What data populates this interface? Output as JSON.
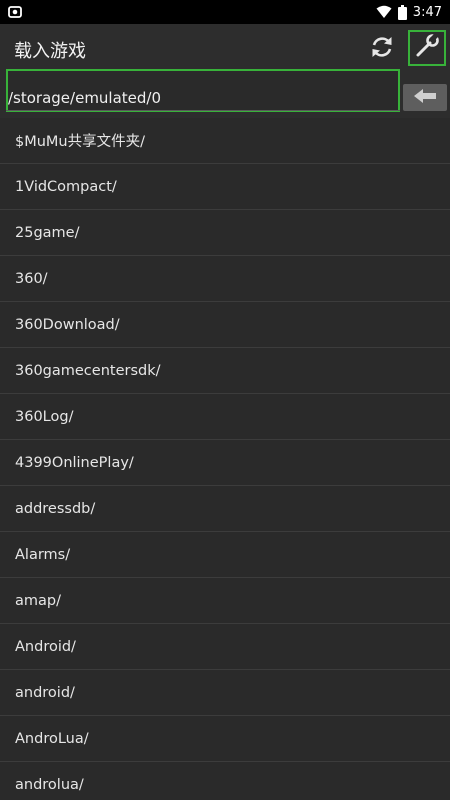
{
  "status_bar": {
    "time": "3:47",
    "icons": [
      "screenshot-icon",
      "wifi-icon",
      "battery-icon"
    ]
  },
  "toolbar": {
    "title": "载入游戏",
    "refresh_icon": "refresh-icon",
    "tools_icon": "wrench-icon"
  },
  "path": {
    "value": "/storage/emulated/0",
    "back_icon": "arrow-left-icon"
  },
  "files": [
    "$MuMu共享文件夹/",
    "1VidCompact/",
    "25game/",
    "360/",
    "360Download/",
    "360gamecentersdk/",
    "360Log/",
    "4399OnlinePlay/",
    "addressdb/",
    "Alarms/",
    "amap/",
    "Android/",
    "android/",
    "AndroLua/",
    "androlua/"
  ],
  "colors": {
    "highlight": "#38b23a",
    "background": "#2b2b2b",
    "back_button": "#5e5e5e"
  }
}
